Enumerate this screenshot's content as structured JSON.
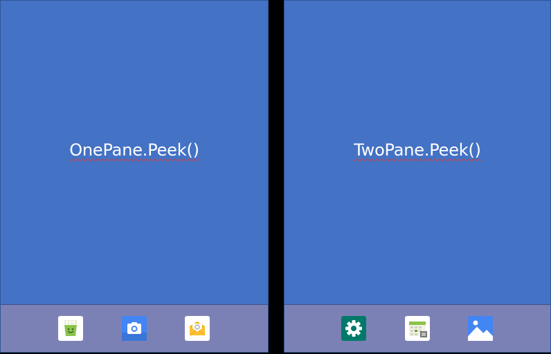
{
  "left_pane": {
    "title": "OnePane.Peek()",
    "dock_icons": [
      "store-icon",
      "camera-icon",
      "email-icon"
    ]
  },
  "right_pane": {
    "title": "TwoPane.Peek()",
    "dock_icons": [
      "settings-icon",
      "calendar-icon",
      "gallery-icon"
    ]
  },
  "colors": {
    "pane_background": "#4472c4",
    "dock_background": "#7c81b5",
    "divider": "#000000",
    "spellcheck_underline": "#d04040"
  }
}
